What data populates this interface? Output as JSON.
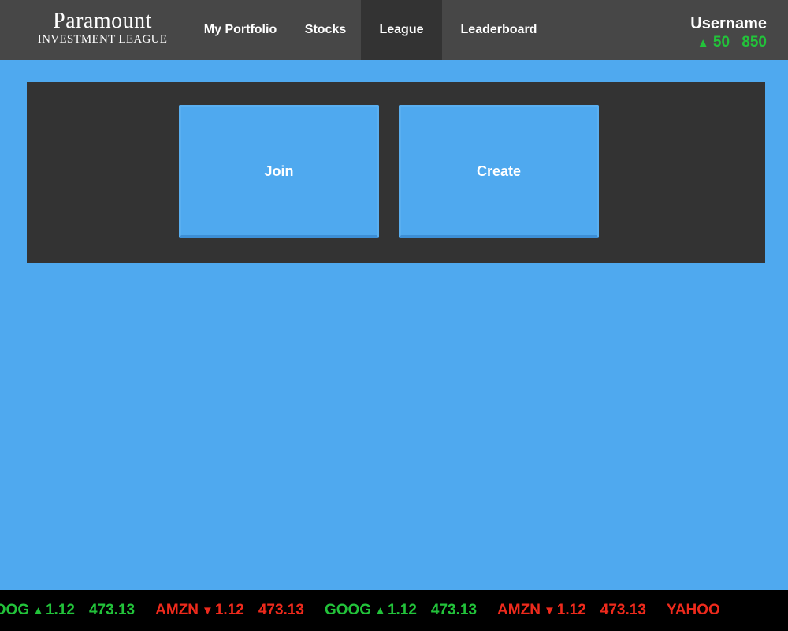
{
  "header": {
    "brand_title": "Paramount",
    "brand_subtitle": "INVESTMENT LEAGUE",
    "nav": {
      "portfolio": "My Portfolio",
      "stocks": "Stocks",
      "league": "League",
      "leaderboard": "Leaderboard"
    },
    "active_nav": "League",
    "user": {
      "name": "Username",
      "change": "50",
      "balance": "850",
      "change_direction": "up",
      "change_icon": "arrow-up-icon"
    }
  },
  "league_panel": {
    "join_label": "Join",
    "create_label": "Create"
  },
  "ticker": {
    "items": [
      {
        "symbol": "GOOG",
        "direction": "up",
        "arrow": "▲",
        "change": "1.12",
        "price": "473.13"
      },
      {
        "symbol": "AMZN",
        "direction": "down",
        "arrow": "▼",
        "change": "1.12",
        "price": "473.13"
      },
      {
        "symbol": "GOOG",
        "direction": "up",
        "arrow": "▲",
        "change": "1.12",
        "price": "473.13"
      },
      {
        "symbol": "AMZN",
        "direction": "down",
        "arrow": "▼",
        "change": "1.12",
        "price": "473.13"
      },
      {
        "symbol": "YAHOO",
        "direction": "down",
        "arrow": "",
        "change": "",
        "price": ""
      }
    ]
  },
  "colors": {
    "background": "#4fa9ef",
    "header": "#474747",
    "panel": "#333333",
    "up": "#22c33a",
    "down": "#ee2a1c"
  }
}
